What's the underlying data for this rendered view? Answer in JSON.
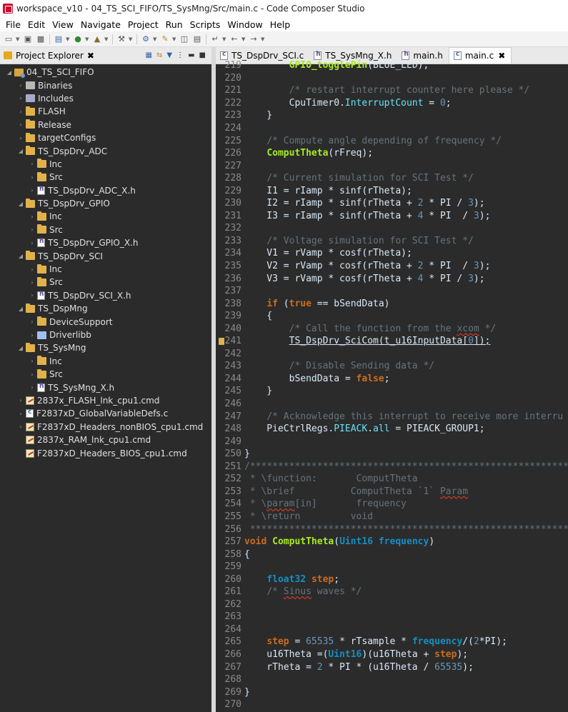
{
  "window": {
    "title": "workspace_v10 - 04_TS_SCI_FIFO/TS_SysMng/Src/main.c - Code Composer Studio"
  },
  "menu": [
    "File",
    "Edit",
    "View",
    "Navigate",
    "Project",
    "Run",
    "Scripts",
    "Window",
    "Help"
  ],
  "project_explorer": {
    "title": "Project Explorer",
    "items": [
      {
        "label": "04_TS_SCI_FIFO",
        "icon": "project-icon",
        "depth": 0,
        "expanded": true
      },
      {
        "label": "Binaries",
        "icon": "binaries-icon",
        "depth": 1,
        "expanded": false
      },
      {
        "label": "Includes",
        "icon": "includes-icon",
        "depth": 1,
        "expanded": false
      },
      {
        "label": "FLASH",
        "icon": "folder-icon",
        "depth": 1,
        "expanded": false
      },
      {
        "label": "Release",
        "icon": "folder-icon",
        "depth": 1,
        "expanded": false
      },
      {
        "label": "targetConfigs",
        "icon": "folder-icon",
        "depth": 1,
        "expanded": false
      },
      {
        "label": "TS_DspDrv_ADC",
        "icon": "folder-icon",
        "depth": 1,
        "expanded": true
      },
      {
        "label": "Inc",
        "icon": "folder-icon",
        "depth": 2,
        "expanded": false
      },
      {
        "label": "Src",
        "icon": "folder-icon",
        "depth": 2,
        "expanded": false
      },
      {
        "label": "TS_DspDrv_ADC_X.h",
        "icon": "header-file-icon",
        "depth": 2,
        "expanded": false
      },
      {
        "label": "TS_DspDrv_GPIO",
        "icon": "folder-icon",
        "depth": 1,
        "expanded": true
      },
      {
        "label": "Inc",
        "icon": "folder-icon",
        "depth": 2,
        "expanded": false
      },
      {
        "label": "Src",
        "icon": "folder-icon",
        "depth": 2,
        "expanded": false
      },
      {
        "label": "TS_DspDrv_GPIO_X.h",
        "icon": "header-file-icon",
        "depth": 2,
        "expanded": false
      },
      {
        "label": "TS_DspDrv_SCI",
        "icon": "folder-icon",
        "depth": 1,
        "expanded": true
      },
      {
        "label": "Inc",
        "icon": "folder-icon",
        "depth": 2,
        "expanded": false
      },
      {
        "label": "Src",
        "icon": "folder-icon",
        "depth": 2,
        "expanded": false
      },
      {
        "label": "TS_DspDrv_SCI_X.h",
        "icon": "header-file-icon",
        "depth": 2,
        "expanded": false
      },
      {
        "label": "TS_DspMng",
        "icon": "folder-icon",
        "depth": 1,
        "expanded": true
      },
      {
        "label": "DeviceSupport",
        "icon": "folder-icon",
        "depth": 2,
        "expanded": false
      },
      {
        "label": "Driverlibb",
        "icon": "library-icon",
        "depth": 2,
        "expanded": false
      },
      {
        "label": "TS_SysMng",
        "icon": "folder-icon",
        "depth": 1,
        "expanded": true
      },
      {
        "label": "Inc",
        "icon": "folder-icon",
        "depth": 2,
        "expanded": false
      },
      {
        "label": "Src",
        "icon": "folder-icon",
        "depth": 2,
        "expanded": false
      },
      {
        "label": "TS_SysMng_X.h",
        "icon": "header-file-icon",
        "depth": 2,
        "expanded": false
      },
      {
        "label": "2837x_FLASH_lnk_cpu1.cmd",
        "icon": "cmd-file-icon",
        "depth": 1,
        "expanded": false
      },
      {
        "label": "F2837xD_GlobalVariableDefs.c",
        "icon": "c-file-icon",
        "depth": 1,
        "expanded": false
      },
      {
        "label": "F2837xD_Headers_nonBIOS_cpu1.cmd",
        "icon": "cmd-file-icon",
        "depth": 1,
        "expanded": false
      },
      {
        "label": "2837x_RAM_lnk_cpu1.cmd",
        "icon": "cmd-file-icon",
        "depth": 1,
        "expanded": null
      },
      {
        "label": "F2837xD_Headers_BIOS_cpu1.cmd",
        "icon": "cmd-file-icon",
        "depth": 1,
        "expanded": null
      }
    ]
  },
  "editor": {
    "tabs": [
      {
        "label": "TS_DspDrv_SCI.c",
        "icon": "c-file-icon",
        "active": false
      },
      {
        "label": "TS_SysMng_X.h",
        "icon": "header-file-icon",
        "active": false
      },
      {
        "label": "main.h",
        "icon": "header-file-icon",
        "active": false
      },
      {
        "label": "main.c",
        "icon": "c-file-icon",
        "active": true
      }
    ],
    "lines": [
      {
        "n": "219",
        "t": [
          [
            "",
            "        "
          ],
          [
            "fn",
            "GPIO_togglePin"
          ],
          [
            "",
            "(BLUE_LED);"
          ]
        ]
      },
      {
        "n": "220",
        "t": []
      },
      {
        "n": "221",
        "t": [
          [
            "",
            "        "
          ],
          [
            "cm",
            "/* restart interrupt counter here please */"
          ]
        ]
      },
      {
        "n": "222",
        "t": [
          [
            "",
            "        CpuTimer0."
          ],
          [
            "fld",
            "InterruptCount"
          ],
          [
            "",
            " = "
          ],
          [
            "nm",
            "0"
          ],
          [
            "",
            ";"
          ]
        ]
      },
      {
        "n": "223",
        "t": [
          [
            "",
            "    }"
          ]
        ]
      },
      {
        "n": "224",
        "t": []
      },
      {
        "n": "225",
        "t": [
          [
            "",
            "    "
          ],
          [
            "cm",
            "/* Compute angle depending of frequency */"
          ]
        ]
      },
      {
        "n": "226",
        "t": [
          [
            "",
            "    "
          ],
          [
            "fn",
            "ComputTheta"
          ],
          [
            "",
            "(rFreq);"
          ]
        ]
      },
      {
        "n": "227",
        "t": []
      },
      {
        "n": "228",
        "t": [
          [
            "",
            "    "
          ],
          [
            "cm",
            "/* Current simulation for SCI Test */"
          ]
        ]
      },
      {
        "n": "229",
        "t": [
          [
            "",
            "    I1 = rIamp * sinf(rTheta);"
          ]
        ]
      },
      {
        "n": "230",
        "t": [
          [
            "",
            "    I2 = rIamp * sinf(rTheta + "
          ],
          [
            "nm",
            "2"
          ],
          [
            "",
            " * PI / "
          ],
          [
            "nm",
            "3"
          ],
          [
            "",
            ");"
          ]
        ]
      },
      {
        "n": "231",
        "t": [
          [
            "",
            "    I3 = rIamp * sinf(rTheta + "
          ],
          [
            "nm",
            "4"
          ],
          [
            "",
            " * PI  / "
          ],
          [
            "nm",
            "3"
          ],
          [
            "",
            ");"
          ]
        ]
      },
      {
        "n": "232",
        "t": []
      },
      {
        "n": "233",
        "t": [
          [
            "",
            "    "
          ],
          [
            "cm",
            "/* Voltage simulation for SCI Test */"
          ]
        ]
      },
      {
        "n": "234",
        "t": [
          [
            "",
            "    V1 = rVamp * cosf(rTheta);"
          ]
        ]
      },
      {
        "n": "235",
        "t": [
          [
            "",
            "    V2 = rVamp * cosf(rTheta + "
          ],
          [
            "nm",
            "2"
          ],
          [
            "",
            " * PI  / "
          ],
          [
            "nm",
            "3"
          ],
          [
            "",
            ");"
          ]
        ]
      },
      {
        "n": "236",
        "t": [
          [
            "",
            "    V3 = rVamp * cosf(rTheta + "
          ],
          [
            "nm",
            "4"
          ],
          [
            "",
            " * PI / "
          ],
          [
            "nm",
            "3"
          ],
          [
            "",
            ");"
          ]
        ]
      },
      {
        "n": "237",
        "t": []
      },
      {
        "n": "238",
        "t": [
          [
            "",
            "    "
          ],
          [
            "kw",
            "if"
          ],
          [
            "",
            " ("
          ],
          [
            "kw",
            "true"
          ],
          [
            "",
            " == bSendData)"
          ]
        ]
      },
      {
        "n": "239",
        "t": [
          [
            "",
            "    {"
          ]
        ]
      },
      {
        "n": "240",
        "t": [
          [
            "",
            "        "
          ],
          [
            "cm",
            "/* Call the function from the "
          ],
          [
            "cm sq",
            "xcom"
          ],
          [
            "cm",
            " */"
          ]
        ]
      },
      {
        "n": "241",
        "marker": true,
        "t": [
          [
            "",
            "        "
          ],
          [
            "sq-plain",
            "TS_DspDrv_SciCom(t_u16InputData["
          ],
          [
            "nm sq-plain",
            "0"
          ],
          [
            "sq-plain",
            "]);"
          ]
        ]
      },
      {
        "n": "242",
        "t": []
      },
      {
        "n": "243",
        "t": [
          [
            "",
            "        "
          ],
          [
            "cm",
            "/* Disable Sending data */"
          ]
        ]
      },
      {
        "n": "244",
        "t": [
          [
            "",
            "        bSendData = "
          ],
          [
            "kw",
            "false"
          ],
          [
            "",
            ";"
          ]
        ]
      },
      {
        "n": "245",
        "t": [
          [
            "",
            "    }"
          ]
        ]
      },
      {
        "n": "246",
        "t": []
      },
      {
        "n": "247",
        "t": [
          [
            "",
            "    "
          ],
          [
            "cm",
            "/* Acknowledge this interrupt to receive more interru"
          ]
        ]
      },
      {
        "n": "248",
        "t": [
          [
            "",
            "    PieCtrlRegs."
          ],
          [
            "fld",
            "PIEACK"
          ],
          [
            "",
            "."
          ],
          [
            "fld",
            "all"
          ],
          [
            "",
            " = PIEACK_GROUP1;"
          ]
        ]
      },
      {
        "n": "249",
        "t": []
      },
      {
        "n": "250",
        "t": [
          [
            "",
            "}"
          ]
        ]
      },
      {
        "n": "251",
        "t": [
          [
            "cm",
            "/*******************************************************************"
          ]
        ]
      },
      {
        "n": "252",
        "t": [
          [
            "cm",
            " * \\function:       ComputTheta"
          ]
        ]
      },
      {
        "n": "253",
        "t": [
          [
            "cm",
            " * \\brief          ComputTheta `1` "
          ],
          [
            "cm sq",
            "Param"
          ]
        ]
      },
      {
        "n": "254",
        "t": [
          [
            "cm",
            " * \\"
          ],
          [
            "cm sq",
            "param"
          ],
          [
            "cm",
            "[in]       frequency"
          ]
        ]
      },
      {
        "n": "255",
        "t": [
          [
            "cm",
            " * \\return         void"
          ]
        ]
      },
      {
        "n": "256",
        "t": [
          [
            "cm",
            " *******************************************************************"
          ]
        ]
      },
      {
        "n": "257",
        "t": [
          [
            "kw",
            "void"
          ],
          [
            "",
            " "
          ],
          [
            "fn",
            "ComputTheta"
          ],
          [
            "",
            "("
          ],
          [
            "ty",
            "Uint16"
          ],
          [
            "",
            " "
          ],
          [
            "ty",
            "frequency"
          ],
          [
            "",
            ")"
          ]
        ]
      },
      {
        "n": "258",
        "t": [
          [
            "",
            "{"
          ]
        ]
      },
      {
        "n": "259",
        "t": []
      },
      {
        "n": "260",
        "t": [
          [
            "",
            "    "
          ],
          [
            "ty",
            "float32"
          ],
          [
            "",
            " "
          ],
          [
            "kw",
            "step"
          ],
          [
            "",
            ";"
          ]
        ]
      },
      {
        "n": "261",
        "t": [
          [
            "",
            "    "
          ],
          [
            "cm",
            "/* "
          ],
          [
            "cm sq",
            "Sinus"
          ],
          [
            "cm",
            " waves */"
          ]
        ]
      },
      {
        "n": "262",
        "t": []
      },
      {
        "n": "263",
        "t": []
      },
      {
        "n": "264",
        "t": []
      },
      {
        "n": "265",
        "t": [
          [
            "",
            "    "
          ],
          [
            "kw",
            "step"
          ],
          [
            "",
            " = "
          ],
          [
            "nm",
            "65535"
          ],
          [
            "",
            " * rTsample * "
          ],
          [
            "ty",
            "frequency"
          ],
          [
            "",
            "/("
          ],
          [
            "nm",
            "2"
          ],
          [
            "",
            "*PI);"
          ]
        ]
      },
      {
        "n": "266",
        "t": [
          [
            "",
            "    u16Theta =("
          ],
          [
            "ty",
            "Uint16"
          ],
          [
            "",
            ")(u16Theta + "
          ],
          [
            "kw",
            "step"
          ],
          [
            "",
            ");"
          ]
        ]
      },
      {
        "n": "267",
        "t": [
          [
            "",
            "    rTheta = "
          ],
          [
            "nm",
            "2"
          ],
          [
            "",
            " * PI * (u16Theta / "
          ],
          [
            "nm",
            "65535"
          ],
          [
            "",
            ");"
          ]
        ]
      },
      {
        "n": "268",
        "t": []
      },
      {
        "n": "269",
        "t": [
          [
            "",
            "}"
          ]
        ]
      },
      {
        "n": "270",
        "t": []
      }
    ]
  }
}
